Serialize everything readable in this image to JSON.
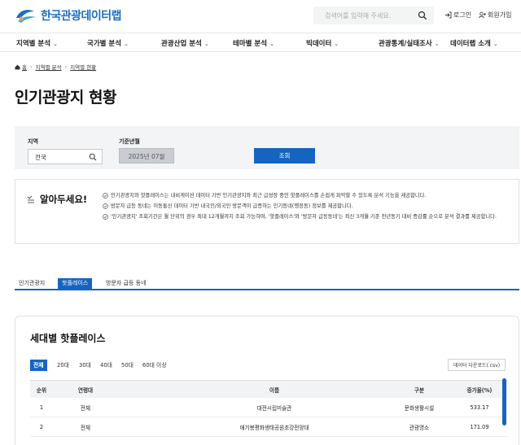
{
  "header": {
    "logo_text": "한국관광데이터랩",
    "search_placeholder": "검색어를 입력해 주세요.",
    "login_label": "로그인",
    "signup_label": "회원가입"
  },
  "nav": {
    "items": [
      {
        "label": "지역별 분석"
      },
      {
        "label": "국가별 분석"
      },
      {
        "label": "관광산업 분석"
      },
      {
        "label": "테마별 분석"
      },
      {
        "label": "빅데이터"
      },
      {
        "label": "관광통계/실태조사"
      },
      {
        "label": "데이터랩 소개"
      }
    ]
  },
  "breadcrumb": {
    "home": "홈",
    "level1": "지역별 분석",
    "level2": "지역별 현황"
  },
  "page_title": "인기관광지 현황",
  "filter": {
    "region_label": "지역",
    "region_value": "전국",
    "date_label": "기준년월",
    "date_value": "2025년 07월",
    "query_label": "조회"
  },
  "notice": {
    "title": "알아두세요!",
    "items": [
      "인기관광지와 핫플레이스는 내비게이션 데이터 기반 인기관광지와 최근 급성장 중인 핫플레이스를 손쉽게 파악할 수 있도록 분석 기능을 제공합니다.",
      "방문자 급등 동네는 이동통신 데이터 기반 내국인/외국인 방문객이 급증하는 인기동네(행정동) 정보를 제공합니다.",
      "'인기관광지' 조회기간은 월 단위의 경우 최대 12개월까지 조회 가능하며, '핫플레이스'와 '방문자 급등동네'는 최신 3개월 기준 전년동기 대비 증감률 순으로 분석 결과를 제공합니다."
    ]
  },
  "tabs": [
    {
      "label": "인기관광지"
    },
    {
      "label": "핫플레이스"
    },
    {
      "label": "방문자 급등 동네"
    }
  ],
  "card": {
    "title": "세대별 핫플레이스",
    "segments": [
      {
        "label": "전체"
      },
      {
        "label": "20대"
      },
      {
        "label": "30대"
      },
      {
        "label": "40대"
      },
      {
        "label": "50대"
      },
      {
        "label": "60대 이상"
      }
    ],
    "download_label": "데이터 다운로드(.csv)",
    "table": {
      "headers": {
        "rank": "순위",
        "age": "연령대",
        "name": "이름",
        "category": "구분",
        "rate": "증가율(%)"
      },
      "rows": [
        {
          "rank": "1",
          "age": "전체",
          "name": "대전시립미술관",
          "category": "문화생활시설",
          "rate": "533.17"
        },
        {
          "rank": "2",
          "age": "전체",
          "name": "애기봉평화생태공원조강전망대",
          "category": "관광명소",
          "rate": "171.09"
        }
      ]
    }
  },
  "colors": {
    "primary": "#1565c0",
    "logo": "#1a6fc4",
    "panel": "#f2f4f6"
  }
}
